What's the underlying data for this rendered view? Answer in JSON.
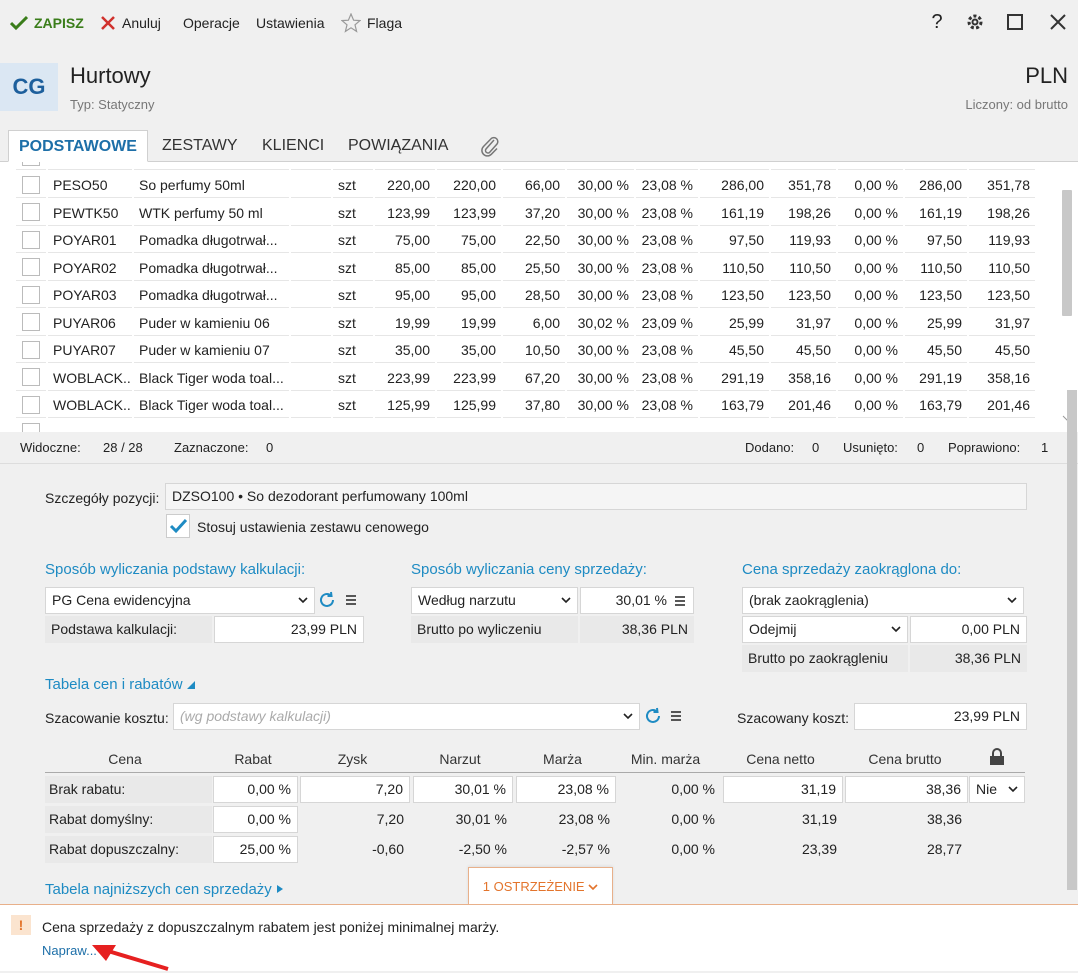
{
  "toolbar": {
    "save": "ZAPISZ",
    "cancel": "Anuluj",
    "operations": "Operacje",
    "settings": "Ustawienia",
    "flag": "Flaga"
  },
  "header": {
    "avatar": "CG",
    "title": "Hurtowy",
    "subtitle": "Typ: Statyczny",
    "currency": "PLN",
    "counted": "Liczony: od brutto"
  },
  "tabs": [
    "PODSTAWOWE",
    "ZESTAWY",
    "KLIENCI",
    "POWIĄZANIA"
  ],
  "grid": {
    "rows": [
      {
        "code": "PESO50",
        "name": "So perfumy 50ml",
        "unit": "szt",
        "c1": "220,00",
        "c2": "220,00",
        "c3": "66,00",
        "c4": "30,00 %",
        "c5": "23,08 %",
        "c6": "286,00",
        "c7": "351,78",
        "c8": "0,00 %",
        "c9": "286,00",
        "c10": "351,78"
      },
      {
        "code": "PEWTK50",
        "name": "WTK perfumy 50 ml",
        "unit": "szt",
        "c1": "123,99",
        "c2": "123,99",
        "c3": "37,20",
        "c4": "30,00 %",
        "c5": "23,08 %",
        "c6": "161,19",
        "c7": "198,26",
        "c8": "0,00 %",
        "c9": "161,19",
        "c10": "198,26"
      },
      {
        "code": "POYAR01",
        "name": "Pomadka długotrwał...",
        "unit": "szt",
        "c1": "75,00",
        "c2": "75,00",
        "c3": "22,50",
        "c4": "30,00 %",
        "c5": "23,08 %",
        "c6": "97,50",
        "c7": "119,93",
        "c8": "0,00 %",
        "c9": "97,50",
        "c10": "119,93"
      },
      {
        "code": "POYAR02",
        "name": "Pomadka długotrwał...",
        "unit": "szt",
        "c1": "85,00",
        "c2": "85,00",
        "c3": "25,50",
        "c4": "30,00 %",
        "c5": "23,08 %",
        "c6": "110,50",
        "c7": "110,50",
        "c8": "0,00 %",
        "c9": "110,50",
        "c10": "110,50"
      },
      {
        "code": "POYAR03",
        "name": "Pomadka długotrwał...",
        "unit": "szt",
        "c1": "95,00",
        "c2": "95,00",
        "c3": "28,50",
        "c4": "30,00 %",
        "c5": "23,08 %",
        "c6": "123,50",
        "c7": "123,50",
        "c8": "0,00 %",
        "c9": "123,50",
        "c10": "123,50"
      },
      {
        "code": "PUYAR06",
        "name": "Puder w kamieniu 06",
        "unit": "szt",
        "c1": "19,99",
        "c2": "19,99",
        "c3": "6,00",
        "c4": "30,02 %",
        "c5": "23,09 %",
        "c6": "25,99",
        "c7": "31,97",
        "c8": "0,00 %",
        "c9": "25,99",
        "c10": "31,97"
      },
      {
        "code": "PUYAR07",
        "name": "Puder w kamieniu 07",
        "unit": "szt",
        "c1": "35,00",
        "c2": "35,00",
        "c3": "10,50",
        "c4": "30,00 %",
        "c5": "23,08 %",
        "c6": "45,50",
        "c7": "45,50",
        "c8": "0,00 %",
        "c9": "45,50",
        "c10": "45,50"
      },
      {
        "code": "WOBLACK...",
        "name": "Black Tiger woda toal...",
        "unit": "szt",
        "c1": "223,99",
        "c2": "223,99",
        "c3": "67,20",
        "c4": "30,00 %",
        "c5": "23,08 %",
        "c6": "291,19",
        "c7": "358,16",
        "c8": "0,00 %",
        "c9": "291,19",
        "c10": "358,16"
      },
      {
        "code": "WOBLACK...",
        "name": "Black Tiger woda toal...",
        "unit": "szt",
        "c1": "125,99",
        "c2": "125,99",
        "c3": "37,80",
        "c4": "30,00 %",
        "c5": "23,08 %",
        "c6": "163,79",
        "c7": "201,46",
        "c8": "0,00 %",
        "c9": "163,79",
        "c10": "201,46"
      }
    ]
  },
  "status": {
    "visible_label": "Widoczne:",
    "visible_value": "28 /  28",
    "selected_label": "Zaznaczone:",
    "selected_value": "0",
    "added_label": "Dodano:",
    "added_value": "0",
    "removed_label": "Usunięto:",
    "removed_value": "0",
    "fixed_label": "Poprawiono:",
    "fixed_value": "1"
  },
  "details": {
    "position_label": "Szczegóły pozycji:",
    "position_value": "DZSO100  •  So dezodorant perfumowany 100ml",
    "apply_settings": "Stosuj ustawienia zestawu cenowego",
    "calc_basis_title": "Sposób wyliczania podstawy kalkulacji:",
    "calc_basis_select": "PG  Cena ewidencyjna",
    "calc_basis_label": "Podstawa kalkulacji:",
    "calc_basis_value": "23,99 PLN",
    "sale_price_title": "Sposób wyliczania ceny sprzedaży:",
    "sale_price_select": "Według narzutu",
    "sale_price_pct": "30,01 %",
    "gross_after_label": "Brutto po wyliczeniu",
    "gross_after_value": "38,36 PLN",
    "rounding_title": "Cena sprzedaży zaokrąglona do:",
    "rounding_select": "(brak zaokrąglenia)",
    "rounding_mode": "Odejmij",
    "rounding_value": "0,00 PLN",
    "gross_round_label": "Brutto po zaokrągleniu",
    "gross_round_value": "38,36 PLN",
    "price_table_title": "Tabela cen i rabatów",
    "cost_estimate_label": "Szacowanie kosztu:",
    "cost_estimate_placeholder": "(wg podstawy kalkulacji)",
    "estimated_cost_label": "Szacowany koszt:",
    "estimated_cost_value": "23,99 PLN",
    "lowest_prices_title": "Tabela najniższych cen sprzedaży"
  },
  "price_table": {
    "headers": [
      "Cena",
      "Rabat",
      "Zysk",
      "Narzut",
      "Marża",
      "Min. marża",
      "Cena netto",
      "Cena brutto"
    ],
    "rows": [
      {
        "label": "Brak rabatu:",
        "rabat": "0,00 %",
        "zysk": "7,20",
        "narzut": "30,01 %",
        "marza": "23,08 %",
        "min": "0,00 %",
        "netto": "31,19",
        "brutto": "38,36",
        "lock": "Nie"
      },
      {
        "label": "Rabat domyślny:",
        "rabat": "0,00 %",
        "zysk": "7,20",
        "narzut": "30,01 %",
        "marza": "23,08 %",
        "min": "0,00 %",
        "netto": "31,19",
        "brutto": "38,36"
      },
      {
        "label": "Rabat dopuszczalny:",
        "rabat": "25,00 %",
        "zysk": "-0,60",
        "narzut": "-2,50 %",
        "marza": "-2,57 %",
        "min": "0,00 %",
        "netto": "23,39",
        "brutto": "28,77"
      }
    ]
  },
  "warning": {
    "button": "1 OSTRZEŻENIE",
    "icon": "!",
    "text": "Cena sprzedaży z dopuszczalnym rabatem jest poniżej minimalnej marży.",
    "link": "Napraw..."
  },
  "colors": {
    "accent": "#1e8bc3",
    "save": "#3a7d1a",
    "warning": "#e3742c"
  }
}
